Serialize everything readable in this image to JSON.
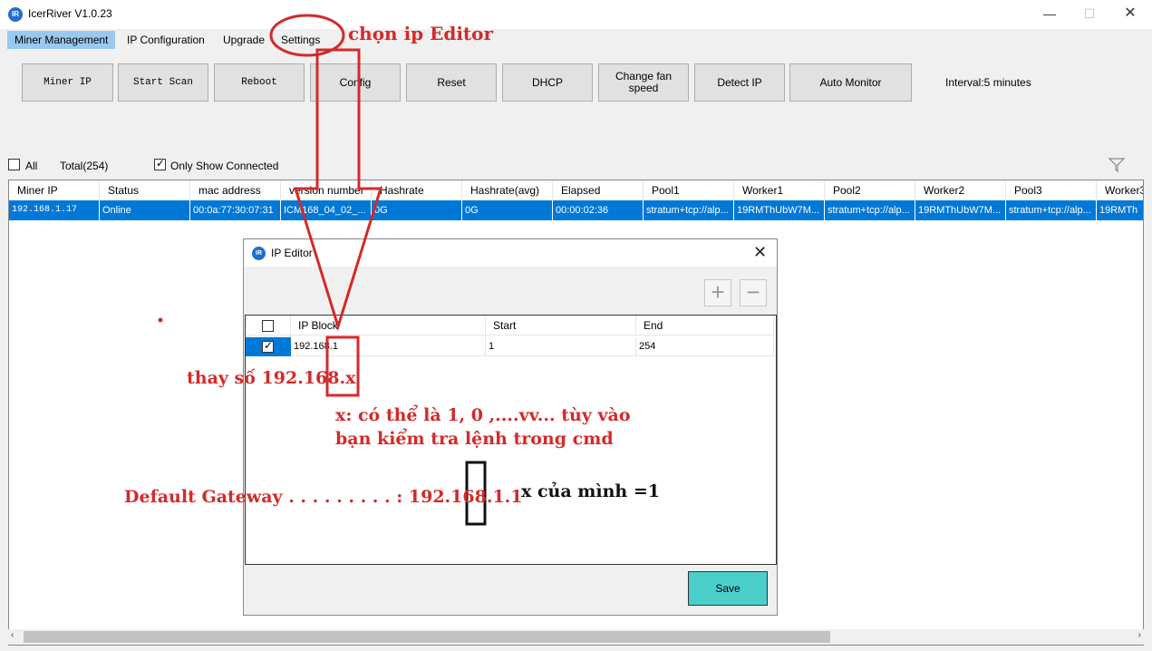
{
  "window": {
    "title": "IcerRiver V1.0.23",
    "logo": "IR",
    "minimize": "—",
    "maximize": "☐",
    "close": "✕"
  },
  "menu": [
    {
      "label": "Miner Management",
      "active": true
    },
    {
      "label": "IP Configuration"
    },
    {
      "label": "Upgrade"
    },
    {
      "label": "Settings"
    }
  ],
  "toolbar": {
    "miner_ip": "Miner IP",
    "start_scan": "Start Scan",
    "reboot": "Reboot",
    "config": "Config",
    "reset": "Reset",
    "dhcp": "DHCP",
    "change_fan_1": "Change fan",
    "change_fan_2": "speed",
    "detect_ip": "Detect IP",
    "auto_monitor": "Auto Monitor",
    "interval": "Interval:5 minutes"
  },
  "filters": {
    "all_label": "All",
    "all_checked": false,
    "total": "Total(254)",
    "only_connected_label": "Only Show Connected",
    "only_connected_checked": true
  },
  "grid": {
    "columns": [
      "Miner IP",
      "Status",
      "mac address",
      "version number",
      "Hashrate",
      "Hashrate(avg)",
      "Elapsed",
      "Pool1",
      "Worker1",
      "Pool2",
      "Worker2",
      "Pool3",
      "Worker3"
    ],
    "rows": [
      [
        "192.168.1.17",
        "Online",
        "00:0a:77:30:07:31",
        "ICM168_04_02_...",
        "0G",
        "0G",
        "00:00:02:36",
        "stratum+tcp://alp...",
        "19RMThUbW7M...",
        "stratum+tcp://alp...",
        "19RMThUbW7M...",
        "stratum+tcp://alp...",
        "19RMTh"
      ]
    ]
  },
  "scroll": {
    "left_arrow": "‹",
    "right_arrow": "›"
  },
  "dialog": {
    "title": "IP Editor",
    "logo": "IR",
    "close": "✕",
    "add": "+",
    "remove": "−",
    "columns": [
      "IP Block",
      "Start",
      "End"
    ],
    "rows": [
      {
        "checked": true,
        "ip_block": "192.168.1",
        "start": "1",
        "end": "254"
      }
    ],
    "save": "Save"
  },
  "annotations": {
    "choose_editor": "chọn ip Editor",
    "replace_number": "thay số 192.168.x",
    "x_line1": "x: có thể là 1, 0 ,....vv... tùy vào",
    "x_line2": "bạn kiểm tra lệnh trong cmd",
    "gateway": "Default Gateway . . . . . . . . . : 192.168.1.1",
    "mine": "x của mình =1"
  },
  "colors": {
    "selection": "#0078d7",
    "menu_active": "#99c9ef",
    "save_button": "#4bcfcb",
    "annotation_red": "#d42a2a"
  }
}
